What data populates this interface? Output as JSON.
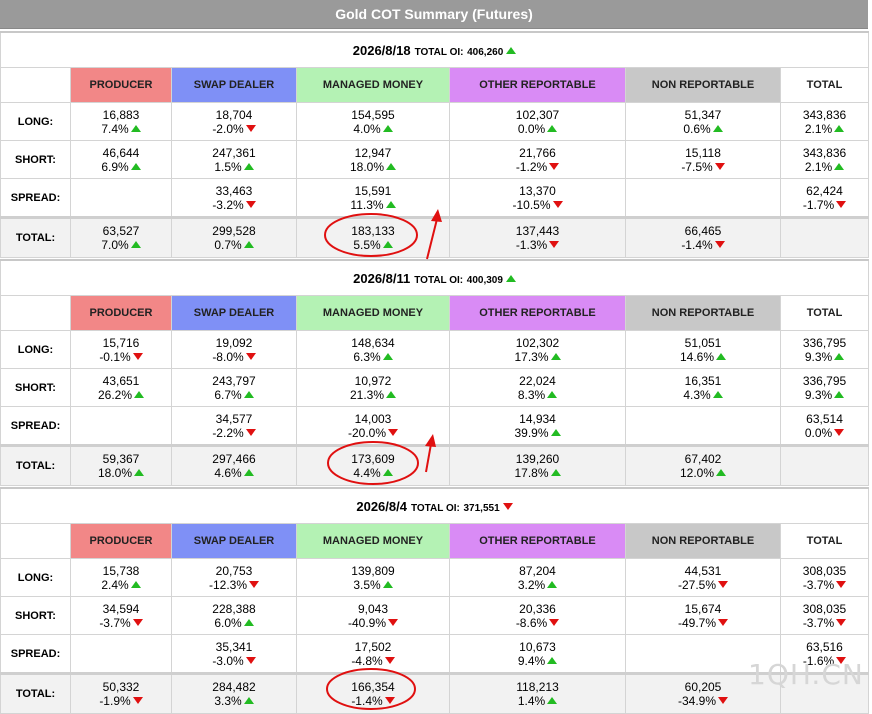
{
  "title": "Gold COT Summary (Futures)",
  "watermark": "1QH.CN",
  "colors": {
    "producer": "#f28787",
    "swap_dealer": "#7f90f6",
    "managed_money": "#b4f2b4",
    "other_reportable": "#d98bf5",
    "non_reportable": "#c8c8c8",
    "up": "#22bb22",
    "down": "#e01010",
    "annotation": "#e01010"
  },
  "headers": {
    "producer": "PRODUCER",
    "swap_dealer": "SWAP DEALER",
    "managed_money": "MANAGED MONEY",
    "other_reportable": "OTHER REPORTABLE",
    "non_reportable": "NON REPORTABLE",
    "total": "TOTAL"
  },
  "row_labels": {
    "long": "LONG:",
    "short": "SHORT:",
    "spread": "SPREAD:",
    "total": "TOTAL:"
  },
  "oi_label": "TOTAL OI:",
  "sections": [
    {
      "date": "2026/8/18",
      "total_oi": "406,260",
      "total_oi_dir": "up",
      "rows": {
        "long": [
          {
            "v": "16,883",
            "p": "7.4%",
            "d": "up"
          },
          {
            "v": "18,704",
            "p": "-2.0%",
            "d": "down"
          },
          {
            "v": "154,595",
            "p": "4.0%",
            "d": "up"
          },
          {
            "v": "102,307",
            "p": "0.0%",
            "d": "up"
          },
          {
            "v": "51,347",
            "p": "0.6%",
            "d": "up"
          },
          {
            "v": "343,836",
            "p": "2.1%",
            "d": "up"
          }
        ],
        "short": [
          {
            "v": "46,644",
            "p": "6.9%",
            "d": "up"
          },
          {
            "v": "247,361",
            "p": "1.5%",
            "d": "up"
          },
          {
            "v": "12,947",
            "p": "18.0%",
            "d": "up"
          },
          {
            "v": "21,766",
            "p": "-1.2%",
            "d": "down"
          },
          {
            "v": "15,118",
            "p": "-7.5%",
            "d": "down"
          },
          {
            "v": "343,836",
            "p": "2.1%",
            "d": "up"
          }
        ],
        "spread": [
          {
            "v": "",
            "p": "",
            "d": ""
          },
          {
            "v": "33,463",
            "p": "-3.2%",
            "d": "down"
          },
          {
            "v": "15,591",
            "p": "11.3%",
            "d": "up"
          },
          {
            "v": "13,370",
            "p": "-10.5%",
            "d": "down"
          },
          {
            "v": "",
            "p": "",
            "d": ""
          },
          {
            "v": "62,424",
            "p": "-1.7%",
            "d": "down"
          }
        ],
        "total": [
          {
            "v": "63,527",
            "p": "7.0%",
            "d": "up"
          },
          {
            "v": "299,528",
            "p": "0.7%",
            "d": "up"
          },
          {
            "v": "183,133",
            "p": "5.5%",
            "d": "up"
          },
          {
            "v": "137,443",
            "p": "-1.3%",
            "d": "down"
          },
          {
            "v": "66,465",
            "p": "-1.4%",
            "d": "down"
          },
          {
            "v": "",
            "p": "",
            "d": ""
          }
        ]
      }
    },
    {
      "date": "2026/8/11",
      "total_oi": "400,309",
      "total_oi_dir": "up",
      "rows": {
        "long": [
          {
            "v": "15,716",
            "p": "-0.1%",
            "d": "down"
          },
          {
            "v": "19,092",
            "p": "-8.0%",
            "d": "down"
          },
          {
            "v": "148,634",
            "p": "6.3%",
            "d": "up"
          },
          {
            "v": "102,302",
            "p": "17.3%",
            "d": "up"
          },
          {
            "v": "51,051",
            "p": "14.6%",
            "d": "up"
          },
          {
            "v": "336,795",
            "p": "9.3%",
            "d": "up"
          }
        ],
        "short": [
          {
            "v": "43,651",
            "p": "26.2%",
            "d": "up"
          },
          {
            "v": "243,797",
            "p": "6.7%",
            "d": "up"
          },
          {
            "v": "10,972",
            "p": "21.3%",
            "d": "up"
          },
          {
            "v": "22,024",
            "p": "8.3%",
            "d": "up"
          },
          {
            "v": "16,351",
            "p": "4.3%",
            "d": "up"
          },
          {
            "v": "336,795",
            "p": "9.3%",
            "d": "up"
          }
        ],
        "spread": [
          {
            "v": "",
            "p": "",
            "d": ""
          },
          {
            "v": "34,577",
            "p": "-2.2%",
            "d": "down"
          },
          {
            "v": "14,003",
            "p": "-20.0%",
            "d": "down"
          },
          {
            "v": "14,934",
            "p": "39.9%",
            "d": "up"
          },
          {
            "v": "",
            "p": "",
            "d": ""
          },
          {
            "v": "63,514",
            "p": "0.0%",
            "d": "down"
          }
        ],
        "total": [
          {
            "v": "59,367",
            "p": "18.0%",
            "d": "up"
          },
          {
            "v": "297,466",
            "p": "4.6%",
            "d": "up"
          },
          {
            "v": "173,609",
            "p": "4.4%",
            "d": "up"
          },
          {
            "v": "139,260",
            "p": "17.8%",
            "d": "up"
          },
          {
            "v": "67,402",
            "p": "12.0%",
            "d": "up"
          },
          {
            "v": "",
            "p": "",
            "d": ""
          }
        ]
      }
    },
    {
      "date": "2026/8/4",
      "total_oi": "371,551",
      "total_oi_dir": "down",
      "rows": {
        "long": [
          {
            "v": "15,738",
            "p": "2.4%",
            "d": "up"
          },
          {
            "v": "20,753",
            "p": "-12.3%",
            "d": "down"
          },
          {
            "v": "139,809",
            "p": "3.5%",
            "d": "up"
          },
          {
            "v": "87,204",
            "p": "3.2%",
            "d": "up"
          },
          {
            "v": "44,531",
            "p": "-27.5%",
            "d": "down"
          },
          {
            "v": "308,035",
            "p": "-3.7%",
            "d": "down"
          }
        ],
        "short": [
          {
            "v": "34,594",
            "p": "-3.7%",
            "d": "down"
          },
          {
            "v": "228,388",
            "p": "6.0%",
            "d": "up"
          },
          {
            "v": "9,043",
            "p": "-40.9%",
            "d": "down"
          },
          {
            "v": "20,336",
            "p": "-8.6%",
            "d": "down"
          },
          {
            "v": "15,674",
            "p": "-49.7%",
            "d": "down"
          },
          {
            "v": "308,035",
            "p": "-3.7%",
            "d": "down"
          }
        ],
        "spread": [
          {
            "v": "",
            "p": "",
            "d": ""
          },
          {
            "v": "35,341",
            "p": "-3.0%",
            "d": "down"
          },
          {
            "v": "17,502",
            "p": "-4.8%",
            "d": "down"
          },
          {
            "v": "10,673",
            "p": "9.4%",
            "d": "up"
          },
          {
            "v": "",
            "p": "",
            "d": ""
          },
          {
            "v": "63,516",
            "p": "-1.6%",
            "d": "down"
          }
        ],
        "total": [
          {
            "v": "50,332",
            "p": "-1.9%",
            "d": "down"
          },
          {
            "v": "284,482",
            "p": "3.3%",
            "d": "up"
          },
          {
            "v": "166,354",
            "p": "-1.4%",
            "d": "down"
          },
          {
            "v": "118,213",
            "p": "1.4%",
            "d": "up"
          },
          {
            "v": "60,205",
            "p": "-34.9%",
            "d": "down"
          },
          {
            "v": "",
            "p": "",
            "d": ""
          }
        ]
      }
    }
  ]
}
